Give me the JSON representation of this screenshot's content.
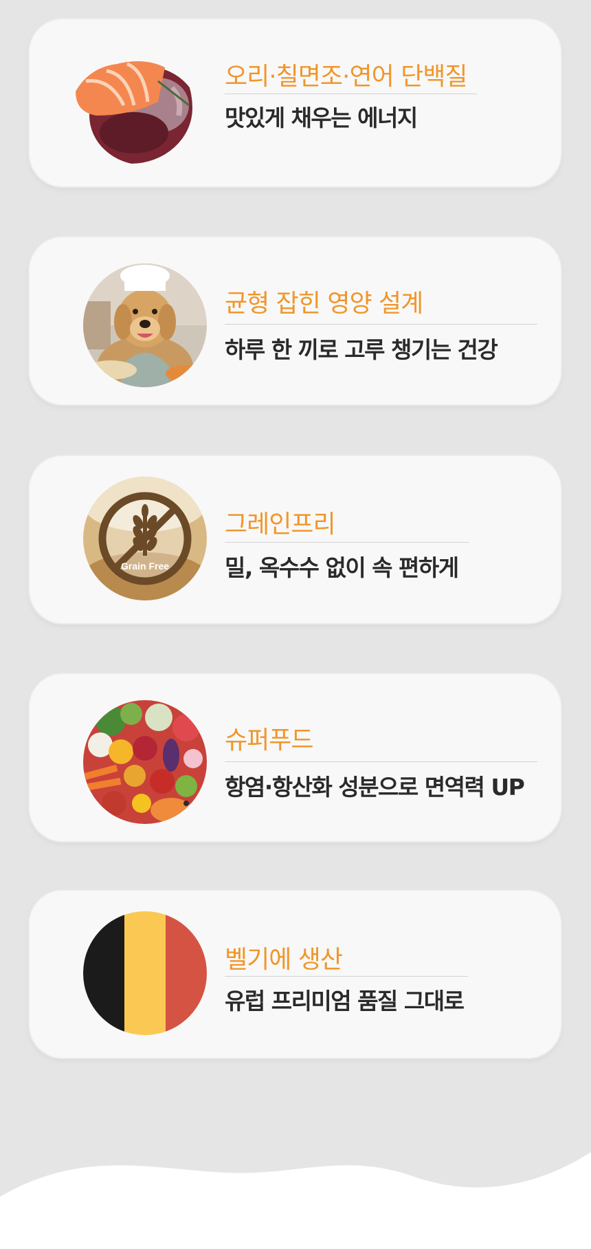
{
  "features": [
    {
      "title": "오리·칠면조·연어 단백질",
      "desc": "맛있게 채우는 에너지",
      "image": "salmon-and-meat-photo"
    },
    {
      "title": "균형 잡힌 영양 설계",
      "desc": "하루 한 끼로 고루 챙기는 건강",
      "image": "chef-dog-photo"
    },
    {
      "title": "그레인프리",
      "desc": "밀, 옥수수 없이 속 편하게",
      "image": "grain-free-icon",
      "badge": "Grain Free"
    },
    {
      "title": "슈퍼푸드",
      "desc": "항염·항산화 성분으로 면역력 UP",
      "image": "vegetables-fruits-photo"
    },
    {
      "title": "벨기에 생산",
      "desc": "유럽 프리미엄 품질 그대로",
      "image": "belgium-flag-icon"
    }
  ],
  "colors": {
    "background": "#e6e5e6",
    "card": "#f8f8f8",
    "title": "#f0962b",
    "desc": "#2a2a2a",
    "flag_black": "#1b1b1b",
    "flag_yellow": "#fbc953",
    "flag_red": "#d55342"
  }
}
